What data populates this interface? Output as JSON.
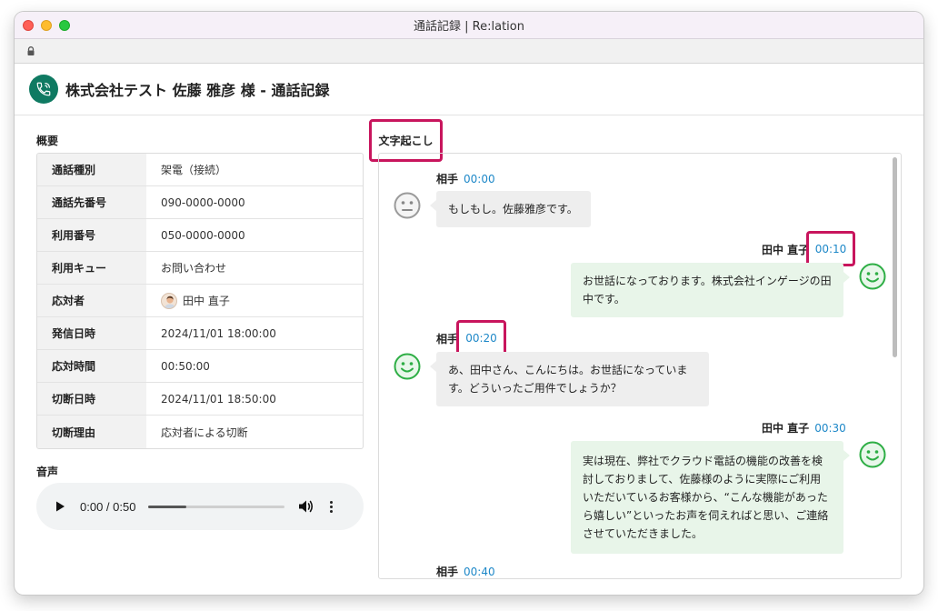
{
  "window": {
    "title": "通話記録 | Re:lation"
  },
  "header": {
    "title": "株式会社テスト 佐藤 雅彦 様 - 通話記録"
  },
  "overview": {
    "label": "概要",
    "rows": [
      {
        "key": "通話種別",
        "value": "架電（接続）"
      },
      {
        "key": "通話先番号",
        "value": "090-0000-0000"
      },
      {
        "key": "利用番号",
        "value": "050-0000-0000"
      },
      {
        "key": "利用キュー",
        "value": "お問い合わせ"
      },
      {
        "key": "応対者",
        "value": "田中 直子"
      },
      {
        "key": "発信日時",
        "value": "2024/11/01 18:00:00"
      },
      {
        "key": "応対時間",
        "value": "00:50:00"
      },
      {
        "key": "切断日時",
        "value": "2024/11/01 18:50:00"
      },
      {
        "key": "切断理由",
        "value": "応対者による切断"
      }
    ]
  },
  "audio": {
    "label": "音声",
    "time": "0:00 / 0:50",
    "progress_fraction": 0.28
  },
  "transcript": {
    "label": "文字起こし",
    "messages": [
      {
        "speaker": "相手",
        "time": "00:00",
        "text": "もしもし。佐藤雅彦です。",
        "face": "neutral-face-icon"
      },
      {
        "speaker": "田中 直子",
        "time": "00:10",
        "text": "お世話になっております。株式会社インゲージの田中です。",
        "face": "smile-face-icon"
      },
      {
        "speaker": "相手",
        "time": "00:20",
        "text": "あ、田中さん、こんにちは。お世話になっています。どういったご用件でしょうか？",
        "face": "smile-face-icon"
      },
      {
        "speaker": "田中 直子",
        "time": "00:30",
        "text": "実は現在、弊社でクラウド電話の機能の改善を検討しておりまして、佐藤様のように実際にご利用いただいているお客様から、“こんな機能があったら嬉しい”といったお声を伺えればと思い、ご連絡させていただきました。",
        "face": "smile-face-icon"
      },
      {
        "speaker": "相手",
        "time": "00:40"
      }
    ]
  },
  "colors": {
    "accent": "#0f7a62",
    "highlight": "#c8155d",
    "timestamp": "#1e88c8",
    "positive": "#2eae45"
  }
}
